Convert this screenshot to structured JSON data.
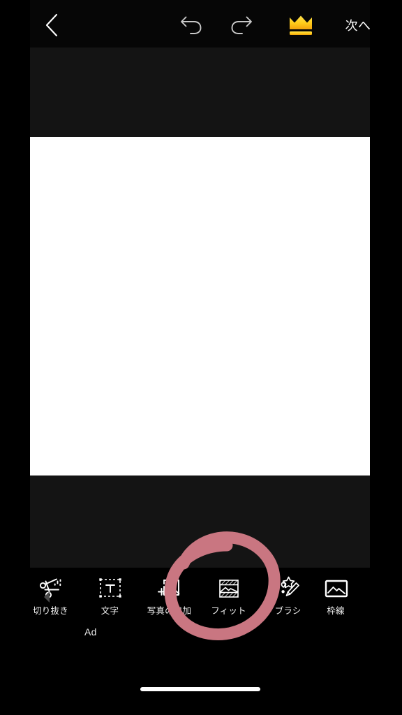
{
  "app": {
    "theme_background": "#000000",
    "stage_background": "#141414",
    "canvas_background": "#ffffff",
    "accent_pink": "#c97681",
    "crown_gold_light": "#ffd42e",
    "crown_gold_dark": "#f39c12"
  },
  "topbar": {
    "back_icon": "chevron-left-icon",
    "undo_icon": "undo-arrow-icon",
    "redo_icon": "redo-arrow-icon",
    "premium_icon": "crown-icon",
    "next_label": "次へ"
  },
  "stage": {
    "canvas_label": "blank-white-canvas"
  },
  "toolbar": {
    "scroll_left_icon": "chevron-left-small-icon",
    "items": [
      {
        "id": "partial-left",
        "label": "ー",
        "icon": "partial-cut-off-icon",
        "selected": false,
        "partial": "left"
      },
      {
        "id": "crop",
        "label": "切り抜き",
        "icon": "scissors-sparkle-icon",
        "selected": false,
        "partial": ""
      },
      {
        "id": "text",
        "label": "文字",
        "icon": "text-box-icon",
        "selected": false,
        "partial": ""
      },
      {
        "id": "add-photo",
        "label": "写真の追加",
        "icon": "add-image-icon",
        "selected": false,
        "partial": ""
      },
      {
        "id": "fit",
        "label": "フィット",
        "icon": "fit-hatch-icon",
        "selected": false,
        "partial": ""
      },
      {
        "id": "brush",
        "label": "ブラシ",
        "icon": "brush-sparkle-icon",
        "selected": false,
        "partial": ""
      },
      {
        "id": "frame",
        "label": "枠線",
        "icon": "frame-picture-icon",
        "selected": false,
        "partial": "right"
      }
    ]
  },
  "ad": {
    "label": "Ad"
  },
  "annotation": {
    "shape": "hand-drawn-circle",
    "color": "#c97681",
    "targets": "add-photo",
    "stroke_width": 17
  },
  "system": {
    "home_indicator": "home-indicator-bar"
  }
}
